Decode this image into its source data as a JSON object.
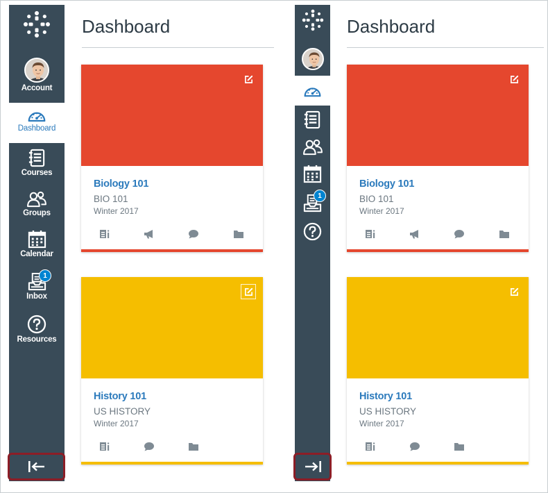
{
  "colors": {
    "nav_bg": "#394b58",
    "active_blue": "#2b7abc",
    "badge_blue": "#0084d1",
    "highlight_red": "#8c1d26"
  },
  "left_nav": {
    "account_label": "Account",
    "dashboard_label": "Dashboard",
    "courses_label": "Courses",
    "groups_label": "Groups",
    "calendar_label": "Calendar",
    "inbox_label": "Inbox",
    "inbox_badge": "1",
    "resources_label": "Resources",
    "collapse_icon": "arrow-left-to-bar-icon"
  },
  "right_nav": {
    "inbox_badge": "1",
    "expand_icon": "arrow-right-to-bar-icon"
  },
  "left_panel": {
    "title": "Dashboard",
    "cards": [
      {
        "name": "Biology 101",
        "code": "BIO 101",
        "term": "Winter 2017",
        "color": "#e5472e",
        "actions": [
          "assignments-icon",
          "announcements-icon",
          "discussions-icon",
          "files-icon"
        ]
      },
      {
        "name": "History 101",
        "code": "US HISTORY",
        "term": "Winter 2017",
        "color": "#f5be00",
        "actions": [
          "assignments-icon",
          "discussions-icon",
          "files-icon"
        ]
      }
    ]
  },
  "right_panel": {
    "title": "Dashboard",
    "cards": [
      {
        "name": "Biology 101",
        "code": "BIO 101",
        "term": "Winter 2017",
        "color": "#e5472e"
      },
      {
        "name": "History 101",
        "code": "US HISTORY",
        "term": "Winter 2017",
        "color": "#f5be00"
      }
    ]
  }
}
